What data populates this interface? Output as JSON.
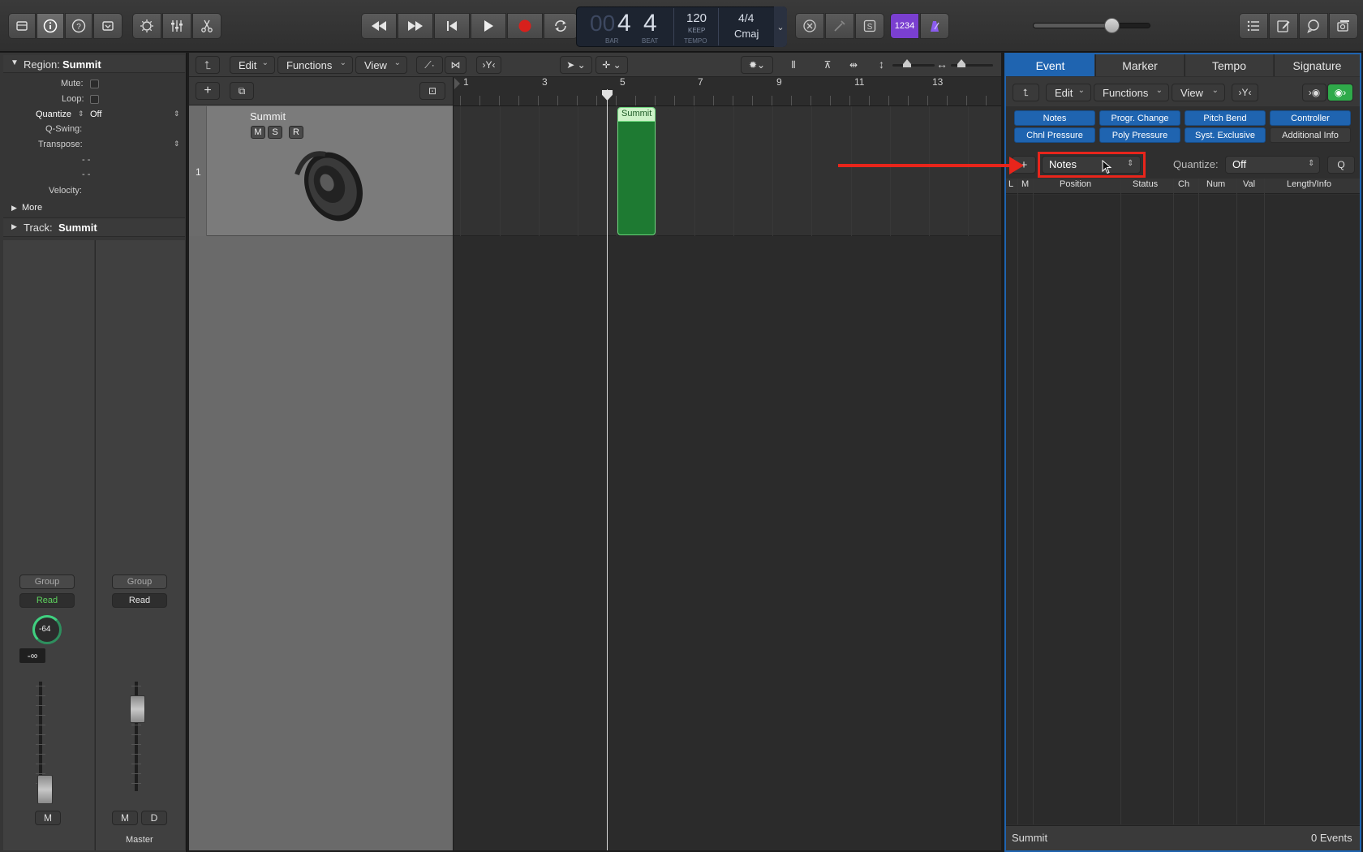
{
  "transport": {
    "bar": "4",
    "beat": "4",
    "bar_prefix": "00",
    "bar_label": "BAR",
    "beat_label": "BEAT",
    "tempo": "120",
    "tempo_keep": "KEEP",
    "tempo_label": "TEMPO",
    "signature": "4/4",
    "key": "Cmaj",
    "count_in": "1234"
  },
  "inspector": {
    "region_label": "Region:",
    "region_name": "Summit",
    "mute_label": "Mute:",
    "loop_label": "Loop:",
    "quantize_label": "Quantize",
    "quantize_value": "Off",
    "qswing_label": "Q-Swing:",
    "transpose_label": "Transpose:",
    "dash1": "- -",
    "dash2": "- -",
    "velocity_label": "Velocity:",
    "more_label": "More",
    "track_label": "Track:",
    "track_name": "Summit"
  },
  "strips": {
    "group_label": "Group",
    "read_label": "Read",
    "pan_value": "-64",
    "volume_value": "-∞",
    "mute_label": "M",
    "dim_label": "D",
    "master_label": "Master"
  },
  "tracks_area": {
    "menus": [
      "Edit",
      "Functions",
      "View"
    ],
    "track_number": "1",
    "track_name": "Summit",
    "mute": "M",
    "solo": "S",
    "record": "R",
    "region_name": "Summit",
    "ruler": [
      "1",
      "3",
      "5",
      "7",
      "9",
      "11",
      "13"
    ]
  },
  "list_editor": {
    "tabs": [
      "Event",
      "Marker",
      "Tempo",
      "Signature"
    ],
    "menus": [
      "Edit",
      "Functions",
      "View"
    ],
    "filters": [
      "Notes",
      "Progr. Change",
      "Pitch Bend",
      "Controller",
      "Chnl Pressure",
      "Poly Pressure",
      "Syst. Exclusive",
      "Additional Info"
    ],
    "add_button": "+",
    "event_type": "Notes",
    "quantize_label": "Quantize:",
    "quantize_value": "Off",
    "q_button": "Q",
    "columns": [
      "L",
      "M",
      "Position",
      "Status",
      "Ch",
      "Num",
      "Val",
      "Length/Info"
    ],
    "footer_name": "Summit",
    "footer_count": "0 Events"
  },
  "colors": {
    "accent_blue": "#1f64b0",
    "region_green": "#1e7a32",
    "highlight_red": "#e8251b",
    "record_red": "#d8201c",
    "count_in_purple": "#7a3fd0"
  }
}
